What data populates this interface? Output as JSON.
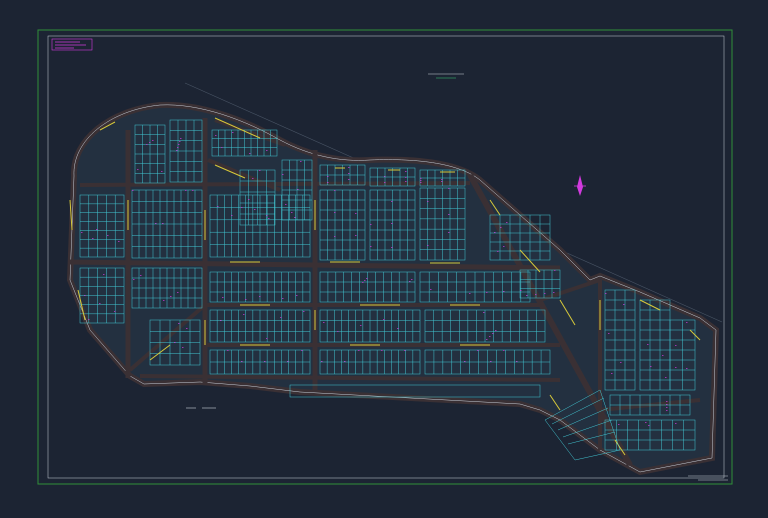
{
  "drawing": {
    "sheet_tag": "",
    "title": "",
    "subtitle": "",
    "street_bottom_label": "",
    "title_block_line1": "",
    "title_block_line2": "",
    "north_arrow_label": "",
    "legend_lines": [
      "",
      "",
      "",
      ""
    ]
  },
  "colors": {
    "background": "#1c2433",
    "outer_frame": "#2f8f3a",
    "inner_frame": "#c9d2dc",
    "roads": "#3a3034",
    "lot_lines": "#42c8d4",
    "street_text": "#d7c93a",
    "accent_text": "#d23adf",
    "white_lines": "#c9d2dc"
  },
  "icons": {
    "north_arrow": "north-arrow-icon"
  }
}
